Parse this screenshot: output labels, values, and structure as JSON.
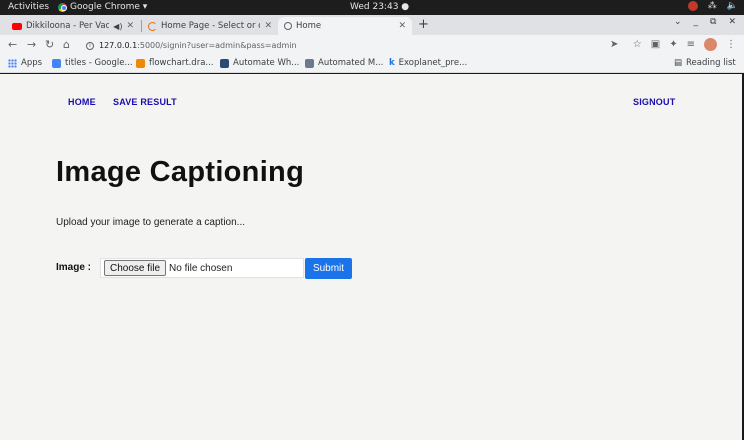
{
  "topbar": {
    "activities": "Activities",
    "app_name": "Google Chrome ▾",
    "clock": "Wed 23:43 ●"
  },
  "tabs": [
    {
      "title": "Dikkiloona - Per Vacha",
      "icon": "youtube-icon"
    },
    {
      "title": "Home Page - Select or cre",
      "icon": "loading-ring-icon"
    },
    {
      "title": "Home",
      "icon": "globe-icon"
    }
  ],
  "toolbar": {
    "url_host": "127.0.0.1",
    "url_rest": ":5000/signin?user=admin&pass=admin"
  },
  "bookmarks": {
    "apps": "Apps",
    "items": [
      {
        "label": "titles - Google...",
        "color": "#4285f4"
      },
      {
        "label": "flowchart.dra...",
        "color": "#f08705"
      },
      {
        "label": "Automate Wh...",
        "color": "#2b4b73"
      },
      {
        "label": "Automated M...",
        "color": "#6b7b8c"
      },
      {
        "label": "Exoplanet_pre...",
        "color": "#1a73e8"
      }
    ],
    "reading_list": "Reading list"
  },
  "nav": {
    "home": "HOME",
    "save_result": "SAVE RESULT",
    "signout": "SIGNOUT"
  },
  "main": {
    "title": "Image Captioning",
    "subtitle": "Upload your image to generate a caption...",
    "image_label": "Image :",
    "choose_file": "Choose file",
    "no_file": "No file chosen",
    "submit": "Submit"
  }
}
